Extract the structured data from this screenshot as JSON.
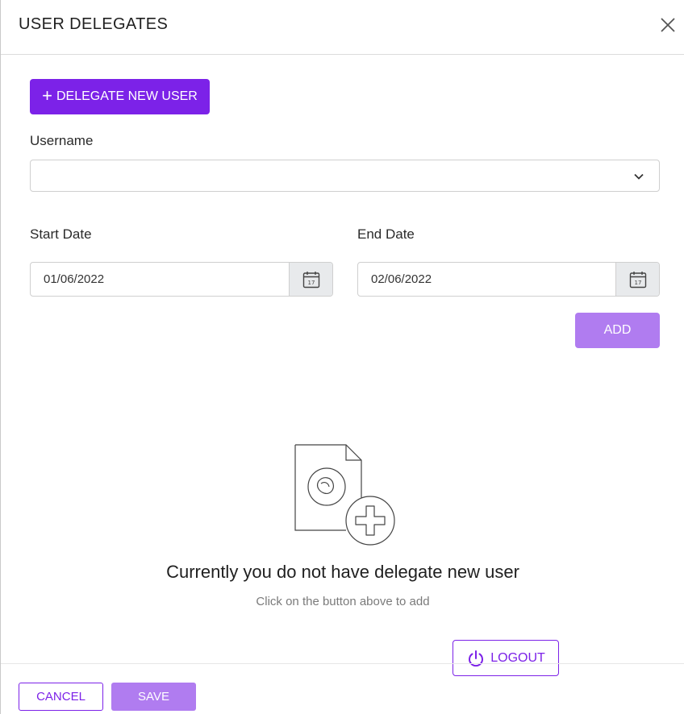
{
  "dialog": {
    "title": "USER DELEGATES",
    "close_icon": "close-icon"
  },
  "delegate_button": {
    "icon": "plus-icon",
    "label": "DELEGATE NEW USER"
  },
  "form": {
    "username_label": "Username",
    "username_value": "",
    "start_date_label": "Start Date",
    "start_date_value": "01/06/2022",
    "end_date_label": "End Date",
    "end_date_value": "02/06/2022",
    "calendar_icon": "calendar-icon",
    "add_label": "ADD"
  },
  "empty_state": {
    "icon": "document-add-icon",
    "title": "Currently you do not have delegate new user",
    "subtitle": "Click on the button above to add"
  },
  "logout": {
    "icon": "power-icon",
    "label": "LOGOUT"
  },
  "footer": {
    "cancel_label": "CANCEL",
    "save_label": "SAVE"
  },
  "colors": {
    "accent": "#7c22e8",
    "accent_light": "#b07cf0",
    "calendar_bg": "#e8eaec"
  }
}
